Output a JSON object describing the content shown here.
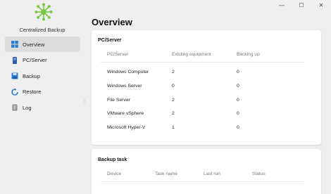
{
  "window": {
    "controls": [
      "—",
      "☐",
      "✕"
    ]
  },
  "sidebar": {
    "app_title": "Centralized Backup",
    "items": [
      {
        "label": "Overview",
        "icon": "overview-grid-icon",
        "active": true
      },
      {
        "label": "PC/Server",
        "icon": "pc-server-icon",
        "active": false
      },
      {
        "label": "Backup",
        "icon": "backup-icon",
        "active": false
      },
      {
        "label": "Restore",
        "icon": "restore-icon",
        "active": false
      },
      {
        "label": "Log",
        "icon": "log-icon",
        "active": false
      }
    ],
    "grip": "⋮"
  },
  "main": {
    "title": "Overview",
    "pcserver": {
      "title": "PC/Server",
      "headers": [
        "PC/Server",
        "Existing equipment",
        "Backing up"
      ],
      "rows": [
        [
          "Windows Computer",
          "2",
          "0"
        ],
        [
          "Windows Server",
          "0",
          "0"
        ],
        [
          "File Server",
          "2",
          "0"
        ],
        [
          "VMware vSphere",
          "2",
          "0"
        ],
        [
          "Microsoft Hyper-V",
          "1",
          "0"
        ]
      ]
    },
    "backup_task": {
      "title": "Backup task",
      "headers": [
        "Device",
        "Task name",
        "Last run",
        "Status"
      ]
    }
  },
  "colors": {
    "accent_green": "#7ac943",
    "active_nav": "#dcdcdc",
    "background": "#efefef"
  }
}
